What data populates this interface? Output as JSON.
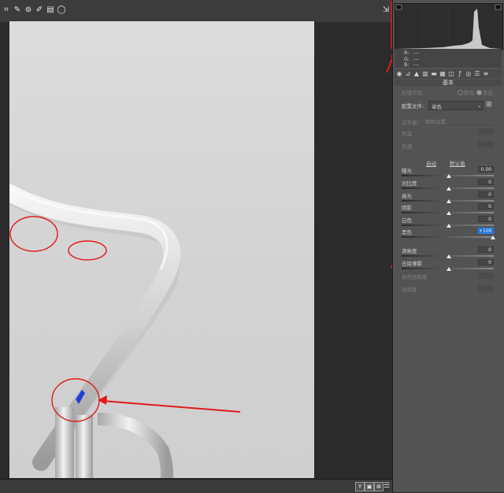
{
  "panel": {
    "process_label": "处理方式:",
    "process_options": [
      "颜色",
      "黑白"
    ],
    "profile_label": "配置文件:",
    "profile_value": "单色",
    "wb_label": "白平衡:",
    "wb_value": "原照设置",
    "temp_label": "色温",
    "tint_label": "色调",
    "auto_link": "自动",
    "default_link": "默认值",
    "section_title": "基本",
    "rgb_labels": [
      "R:",
      "G:",
      "B:"
    ],
    "rgb_values": [
      "---",
      "---",
      "---"
    ],
    "sliders": [
      {
        "label": "曝光",
        "value": "0.00",
        "enabled": true
      },
      {
        "label": "对比度",
        "value": "0",
        "enabled": true
      },
      {
        "label": "高光",
        "value": "0",
        "enabled": true
      },
      {
        "label": "阴影",
        "value": "0",
        "enabled": true
      },
      {
        "label": "白色",
        "value": "0",
        "enabled": true
      },
      {
        "label": "黑色",
        "value": "+100",
        "enabled": true,
        "highlighted": true
      },
      {
        "label": "清晰度",
        "value": "0",
        "enabled": true
      },
      {
        "label": "去除薄雾",
        "value": "0",
        "enabled": true
      },
      {
        "label": "自然饱和度",
        "value": "",
        "enabled": false
      },
      {
        "label": "饱和度",
        "value": "",
        "enabled": false
      }
    ]
  },
  "statusbar": {
    "buttons": [
      "Y",
      "▣",
      "⊞"
    ]
  },
  "colors": {
    "accent_blue": "#1e6fd6",
    "annotation_red": "#e21a1a"
  }
}
